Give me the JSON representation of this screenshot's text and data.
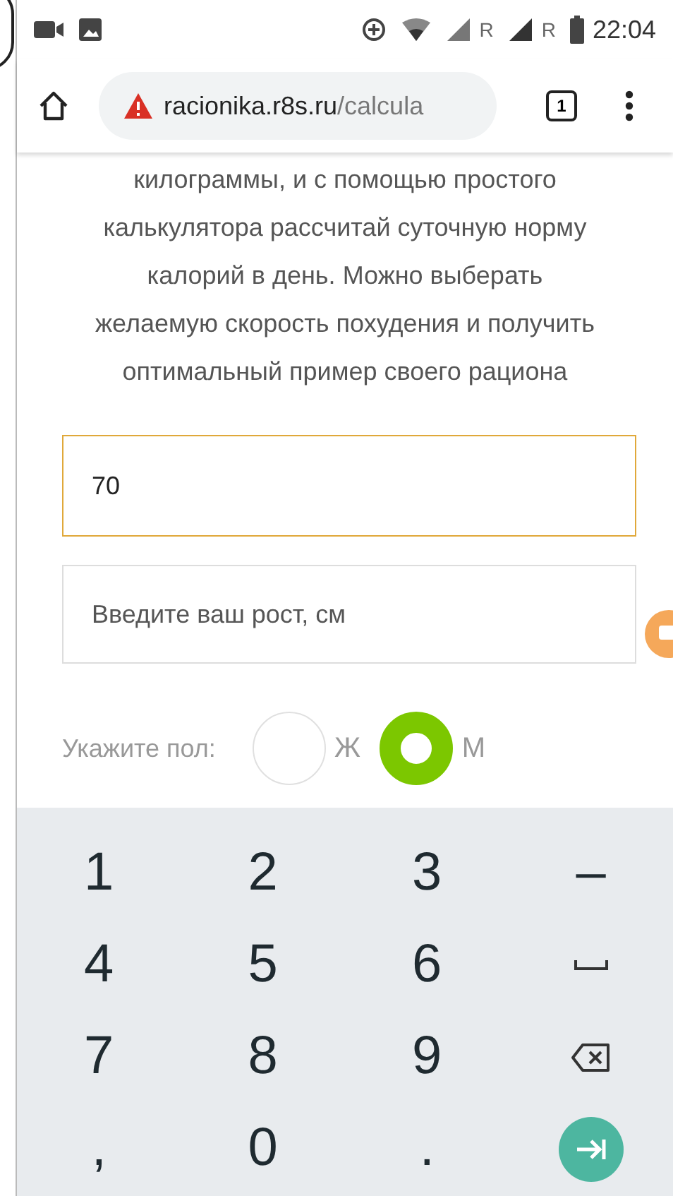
{
  "status_bar": {
    "time": "22:04",
    "network_labels": [
      "R",
      "R"
    ]
  },
  "browser": {
    "url_host": "racionika.r8s.ru",
    "url_path": "/calcula",
    "tab_count": "1",
    "insecure": true
  },
  "intro_lines": [
    "килограммы, и с помощью простого",
    "калькулятора рассчитай суточную норму",
    "калорий в день. Можно выберать",
    "желаемую скорость похудения и получить",
    "оптимальный пример своего рациона"
  ],
  "weight_field": {
    "value": "70",
    "focused": true
  },
  "height_field": {
    "placeholder": "Введите ваш рост, см",
    "focused": false
  },
  "gender": {
    "label": "Укажите пол:",
    "options": [
      {
        "label": "Ж",
        "selected": false
      },
      {
        "label": "М",
        "selected": true
      }
    ]
  },
  "keyboard": [
    [
      {
        "kind": "char",
        "label": "1"
      },
      {
        "kind": "char",
        "label": "2"
      },
      {
        "kind": "char",
        "label": "3"
      },
      {
        "kind": "char",
        "label": "–"
      }
    ],
    [
      {
        "kind": "char",
        "label": "4"
      },
      {
        "kind": "char",
        "label": "5"
      },
      {
        "kind": "char",
        "label": "6"
      },
      {
        "kind": "space"
      }
    ],
    [
      {
        "kind": "char",
        "label": "7"
      },
      {
        "kind": "char",
        "label": "8"
      },
      {
        "kind": "char",
        "label": "9"
      },
      {
        "kind": "backspace"
      }
    ],
    [
      {
        "kind": "char",
        "label": ","
      },
      {
        "kind": "char",
        "label": "0"
      },
      {
        "kind": "char",
        "label": "."
      },
      {
        "kind": "next"
      }
    ]
  ]
}
